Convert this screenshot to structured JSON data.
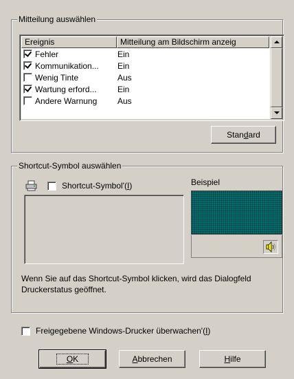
{
  "message_group": {
    "title": "Mitteilung auswählen",
    "columns": [
      "Ereignis",
      "Mitteilung am Bildschirm anzeig"
    ],
    "rows": [
      {
        "event": "Fehler",
        "message": "Ein",
        "checked": true
      },
      {
        "event": "Kommunikation...",
        "message": "Ein",
        "checked": true
      },
      {
        "event": "Wenig Tinte",
        "message": "Aus",
        "checked": false
      },
      {
        "event": "Wartung erford...",
        "message": "Ein",
        "checked": true
      },
      {
        "event": "Andere Warnung",
        "message": "Aus",
        "checked": false
      }
    ],
    "standard_button": {
      "pre": "Stan",
      "key": "d",
      "post": "ard"
    }
  },
  "shortcut_group": {
    "title": "Shortcut-Symbol auswählen",
    "checkbox_label": {
      "pre": "Shortcut-Symbol'(",
      "key": "I",
      "post": ")"
    },
    "checkbox_checked": false,
    "example_label": "Beispiel",
    "description": "Wenn Sie auf das Shortcut-Symbol klicken, wird das Dialogfeld Druckerstatus geöffnet."
  },
  "shared_printers": {
    "label": {
      "pre": "Freigegebene Windows-Drucker überwachen'(",
      "key": "I",
      "post": ")"
    },
    "checked": false
  },
  "buttons": {
    "ok": {
      "pre": "",
      "key": "O",
      "post": "K"
    },
    "cancel": {
      "pre": "",
      "key": "A",
      "post": "bbrechen"
    },
    "help": {
      "pre": "",
      "key": "H",
      "post": "ilfe"
    }
  }
}
